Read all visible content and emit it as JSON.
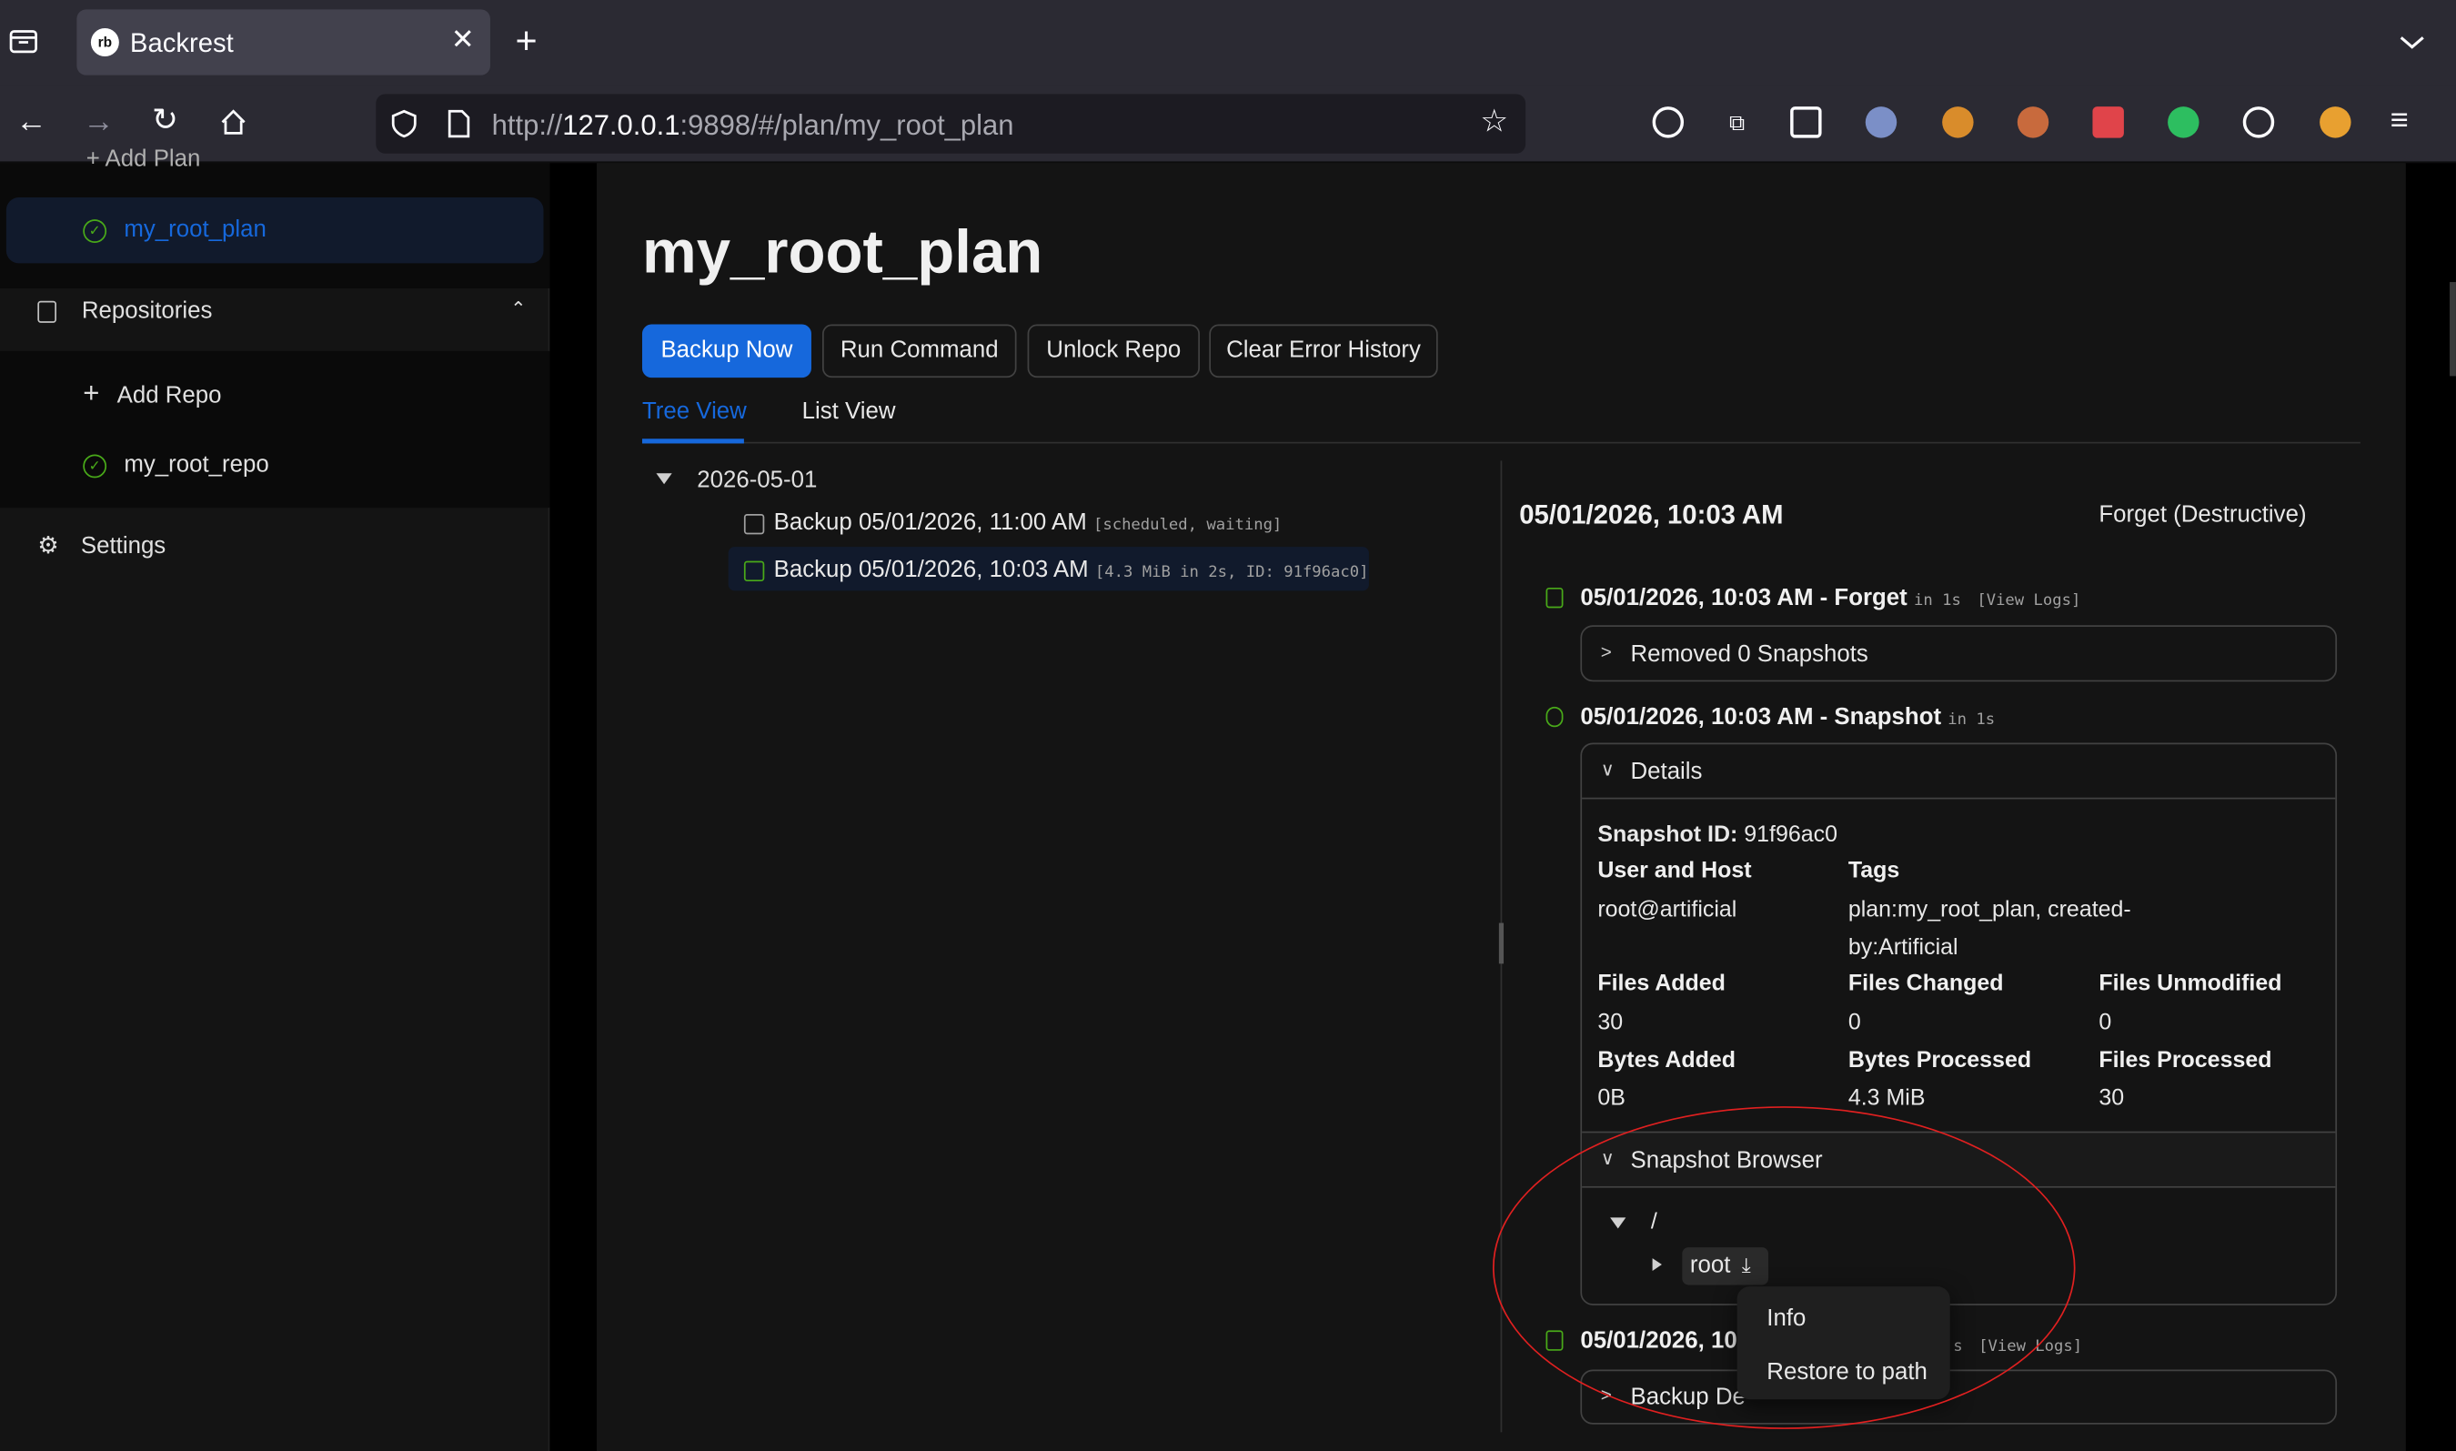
{
  "browser": {
    "tab_title": "Backrest",
    "url_prefix": "http://",
    "url_host": "127.0.0.1",
    "url_rest": ":9898/#/plan/my_root_plan"
  },
  "sidebar": {
    "add_plan": "Add Plan",
    "plan_item": "my_root_plan",
    "repositories": "Repositories",
    "add_repo": "Add Repo",
    "repo_item": "my_root_repo",
    "settings": "Settings"
  },
  "page": {
    "title": "my_root_plan",
    "buttons": {
      "backup_now": "Backup Now",
      "run_command": "Run Command",
      "unlock_repo": "Unlock Repo",
      "clear_error_history": "Clear Error History"
    },
    "tabs": [
      "Tree View",
      "List View"
    ]
  },
  "tree": {
    "date": "2026-05-01",
    "rows": [
      {
        "label": "Backup 05/01/2026, 11:00 AM",
        "meta": "[scheduled, waiting]"
      },
      {
        "label": "Backup 05/01/2026, 10:03 AM",
        "meta": "[4.3 MiB in 2s, ID: 91f96ac0]"
      }
    ]
  },
  "detail": {
    "title": "05/01/2026, 10:03 AM",
    "forget_link": "Forget (Destructive)",
    "forget_op": {
      "title": "05/01/2026, 10:03 AM - Forget",
      "duration": "in 1s",
      "logs": "[View Logs]",
      "panel": "Removed 0 Snapshots"
    },
    "snapshot_op": {
      "title": "05/01/2026, 10:03 AM - Snapshot",
      "duration": "in 1s",
      "details": "Details"
    },
    "snapshot": {
      "id_label": "Snapshot ID:",
      "id_value": "91f96ac0",
      "user_host_label": "User and Host",
      "user_host_value": "root@artificial",
      "tags_label": "Tags",
      "tags_line1": "plan:my_root_plan, created-",
      "tags_line2": "by:Artificial",
      "files_added_label": "Files Added",
      "files_added": "30",
      "files_changed_label": "Files Changed",
      "files_changed": "0",
      "files_unmodified_label": "Files Unmodified",
      "files_unmodified": "0",
      "bytes_added_label": "Bytes Added",
      "bytes_added": "0B",
      "bytes_processed_label": "Bytes Processed",
      "bytes_processed": "4.3 MiB",
      "files_processed_label": "Files Processed",
      "files_processed": "30"
    },
    "browser": {
      "title": "Snapshot Browser",
      "root_path": "/",
      "root_dir": "root"
    },
    "backup_op": {
      "title_visible": "05/01/2026, 10:",
      "duration_tail": "s",
      "logs": "[View Logs]",
      "panel_visible": "Backup De"
    },
    "context_menu": [
      "Info",
      "Restore to path"
    ]
  },
  "colors": {
    "accent": "#1668dc",
    "success": "#49aa19",
    "annotation": "#e02020"
  }
}
